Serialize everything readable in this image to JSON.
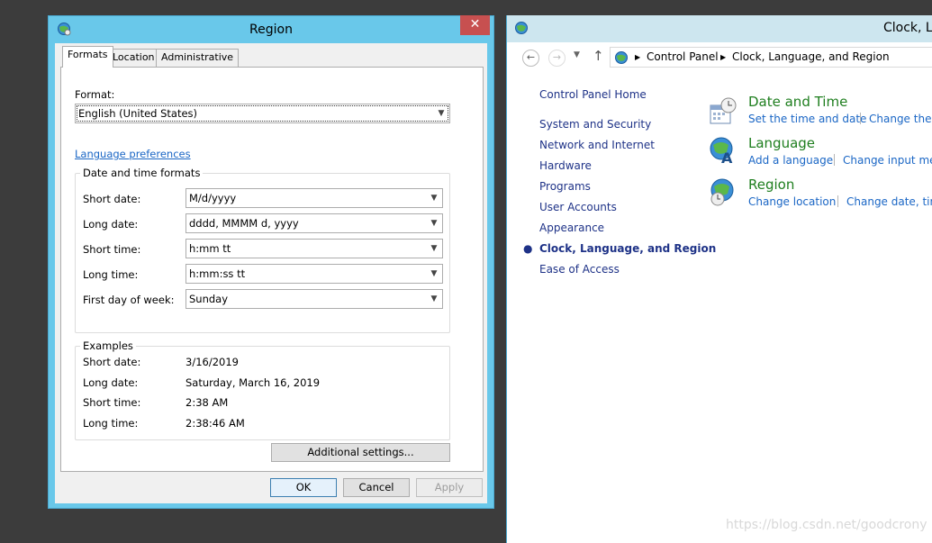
{
  "region_dialog": {
    "title": "Region",
    "close_glyph": "✕",
    "tabs": [
      {
        "label": "Formats",
        "active": true
      },
      {
        "label": "Location",
        "active": false
      },
      {
        "label": "Administrative",
        "active": false
      }
    ],
    "format_label": "Format:",
    "format_value": "English (United States)",
    "language_link": "Language preferences",
    "datetime_group": {
      "title": "Date and time formats",
      "rows": [
        {
          "label": "Short date:",
          "value": "M/d/yyyy"
        },
        {
          "label": "Long date:",
          "value": "dddd, MMMM d, yyyy"
        },
        {
          "label": "Short time:",
          "value": "h:mm tt"
        },
        {
          "label": "Long time:",
          "value": "h:mm:ss tt"
        },
        {
          "label": "First day of week:",
          "value": "Sunday"
        }
      ]
    },
    "examples_group": {
      "title": "Examples",
      "rows": [
        {
          "label": "Short date:",
          "value": "3/16/2019"
        },
        {
          "label": "Long date:",
          "value": "Saturday, March 16, 2019"
        },
        {
          "label": "Short time:",
          "value": "2:38 AM"
        },
        {
          "label": "Long time:",
          "value": "2:38:46 AM"
        }
      ]
    },
    "additional_settings": "Additional settings...",
    "ok": "OK",
    "cancel": "Cancel",
    "apply": "Apply"
  },
  "control_panel": {
    "title": "Clock, La",
    "breadcrumb": [
      "Control Panel",
      "Clock, Language, and Region"
    ],
    "sidebar": {
      "home": "Control Panel Home",
      "items": [
        {
          "label": "System and Security",
          "current": false
        },
        {
          "label": "Network and Internet",
          "current": false
        },
        {
          "label": "Hardware",
          "current": false
        },
        {
          "label": "Programs",
          "current": false
        },
        {
          "label": "User Accounts",
          "current": false
        },
        {
          "label": "Appearance",
          "current": false
        },
        {
          "label": "Clock, Language, and Region",
          "current": true
        },
        {
          "label": "Ease of Access",
          "current": false
        }
      ]
    },
    "categories": [
      {
        "title": "Date and Time",
        "links": [
          "Set the time and date",
          "Change the ti"
        ],
        "icon": "calendar-clock-icon"
      },
      {
        "title": "Language",
        "links": [
          "Add a language",
          "Change input meth"
        ],
        "icon": "language-globe-icon"
      },
      {
        "title": "Region",
        "links": [
          "Change location",
          "Change date, time"
        ],
        "icon": "region-globe-icon"
      }
    ]
  },
  "watermark": "https://blog.csdn.net/goodcrony",
  "colors": {
    "titlebar": "#69c8ea",
    "close": "#c75050",
    "link": "#1a66c5",
    "category_title": "#1e7e1e"
  }
}
